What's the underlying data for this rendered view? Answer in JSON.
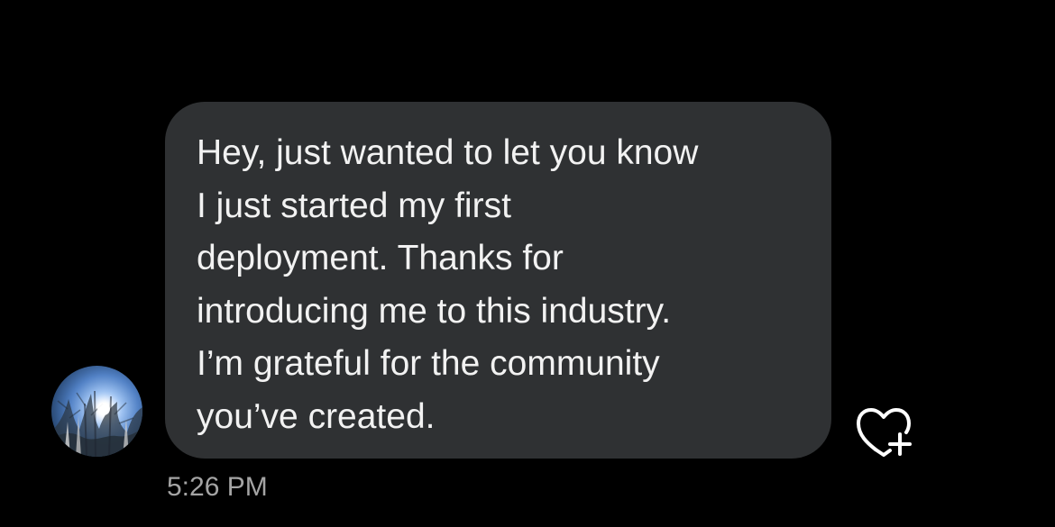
{
  "conversation": {
    "message": {
      "lines": [
        "Hey, just wanted to let you know",
        "I just started my first",
        "deployment. Thanks for",
        "introducing me to this industry.",
        "I’m grateful for the community",
        "you’ve created."
      ],
      "timestamp": "5:26 PM"
    },
    "sender_avatar": {
      "icon": "sunlit-trees-avatar"
    },
    "reaction_button": {
      "icon": "heart-plus-icon"
    }
  },
  "colors": {
    "background": "#000000",
    "bubble": "#2f3133",
    "message_text": "#f2f2f2",
    "timestamp_text": "#a4a4a4",
    "icon": "#ffffff"
  }
}
